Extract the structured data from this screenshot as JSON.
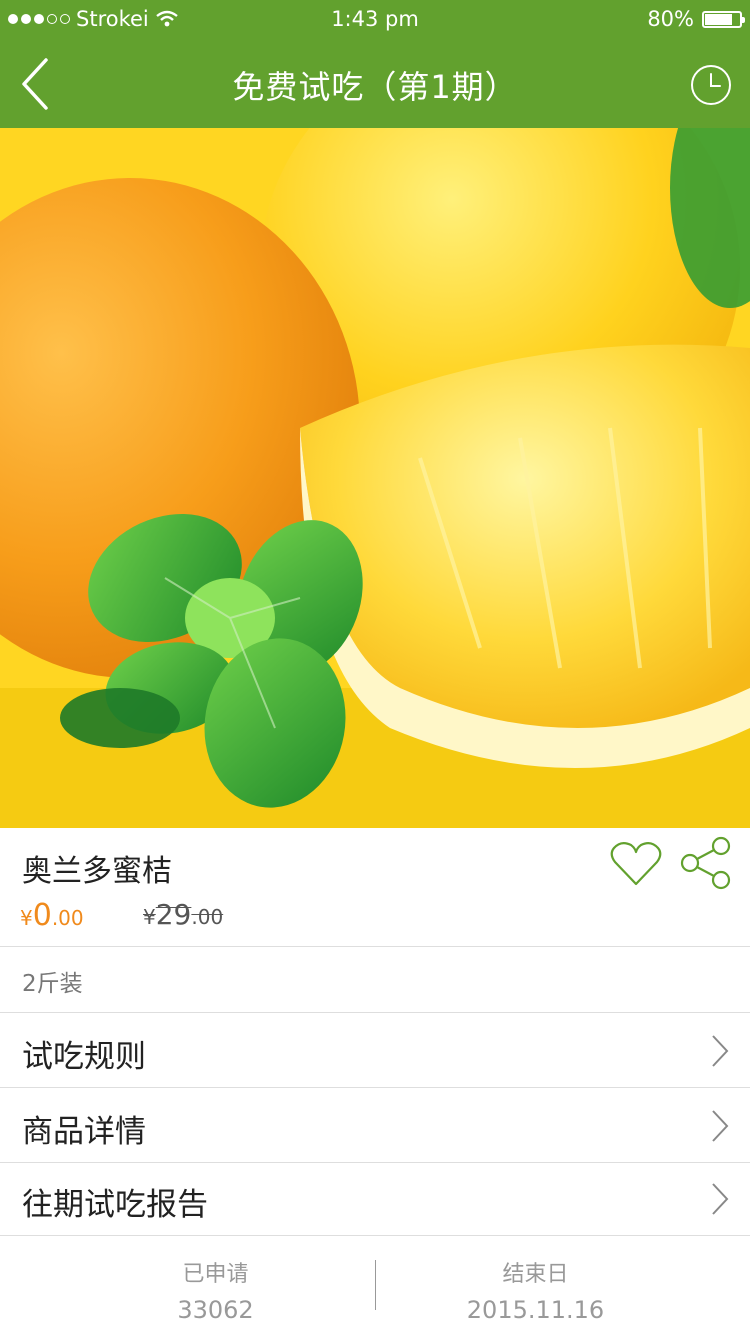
{
  "status_bar": {
    "carrier": "Strokei",
    "time": "1:43 pm",
    "battery": "80%",
    "battery_level": 0.8
  },
  "nav": {
    "title": "免费试吃（第1期）",
    "back_icon": "chevron-left-icon",
    "history_icon": "clock-icon"
  },
  "product": {
    "name": "奥兰多蜜桔",
    "currency": "¥",
    "price_int": "0",
    "price_dec": ".00",
    "old_price_int": "29",
    "old_price_dec": ".00",
    "spec": "2斤装"
  },
  "menu": [
    {
      "label": "试吃规则"
    },
    {
      "label": "商品详情"
    },
    {
      "label": "往期试吃报告"
    }
  ],
  "footer": {
    "applied_label": "已申请",
    "applied_value": "33062",
    "end_label": "结束日",
    "end_value": "2015.11.16"
  },
  "colors": {
    "brand_green": "#62a12e",
    "price_orange": "#f08a1c",
    "muted_gray": "#999999"
  }
}
